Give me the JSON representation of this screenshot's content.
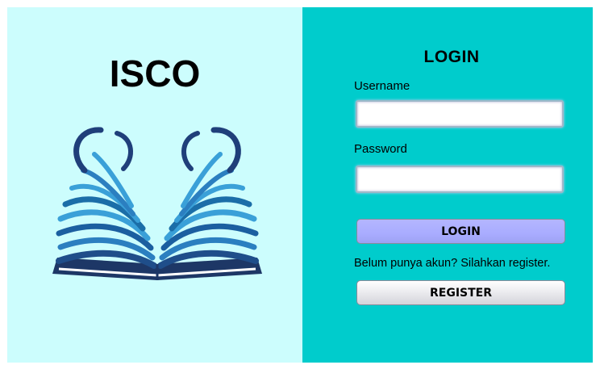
{
  "brand": {
    "title": "ISCO"
  },
  "login": {
    "title": "LOGIN",
    "username_label": "Username",
    "username_value": "",
    "password_label": "Password",
    "password_value": "",
    "login_button": "LOGIN",
    "register_prompt": "Belum punya akun? Silahkan register.",
    "register_button": "REGISTER"
  },
  "colors": {
    "left_bg": "#ccfdfd",
    "right_bg": "#00cccc",
    "login_button": "#aeb0ff",
    "register_button": "#e6e6ea",
    "logo_dark": "#1f3f7a",
    "logo_mid": "#1b6ea8",
    "logo_light": "#3aa0d8"
  },
  "icons": {
    "logo": "open-book-logo-icon"
  }
}
